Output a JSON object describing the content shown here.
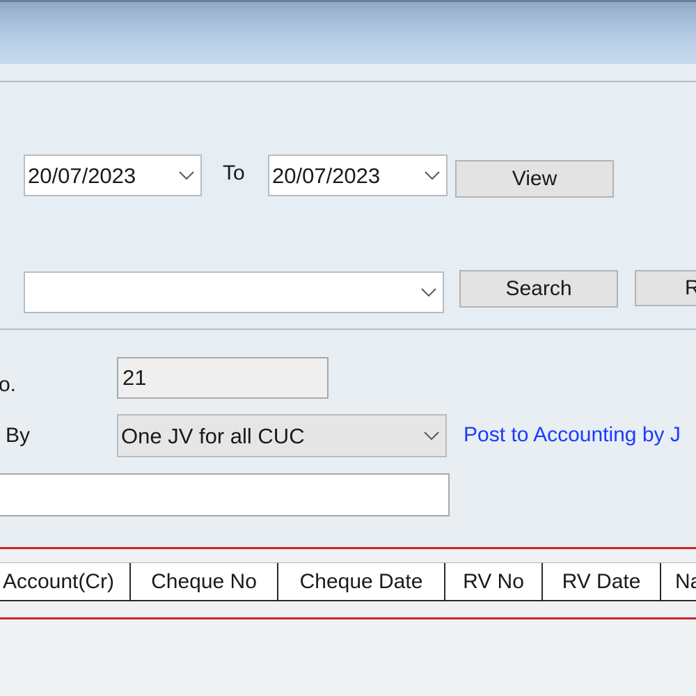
{
  "filters": {
    "from_date": "20/07/2023",
    "to_label": "To",
    "to_date": "20/07/2023",
    "view_label": "View",
    "search_value": "",
    "search_label": "Search",
    "reset_label_partial": "R"
  },
  "form": {
    "no_label_partial": "o.",
    "no_value": "21",
    "by_label_partial": "By",
    "by_value": "One JV for all CUC",
    "post_link": "Post to Accounting by J",
    "remarks_value": ""
  },
  "grid": {
    "columns": [
      "Account(Cr)",
      "Cheque No",
      "Cheque Date",
      "RV No",
      "RV Date",
      "Na"
    ]
  },
  "icons": {
    "chevron": "chevron-down-icon"
  }
}
